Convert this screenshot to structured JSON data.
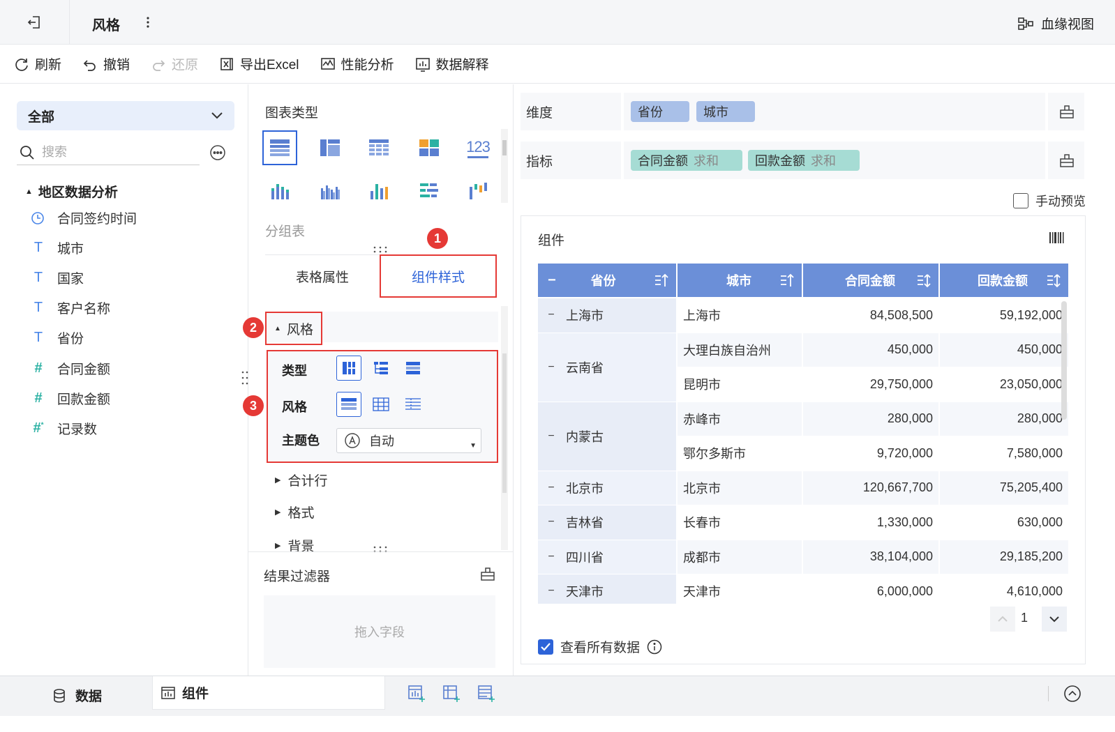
{
  "header": {
    "title": "风格",
    "lineage_label": "血缘视图"
  },
  "toolbar": {
    "refresh": "刷新",
    "undo": "撤销",
    "redo": "还原",
    "export_excel": "导出Excel",
    "perf_analysis": "性能分析",
    "data_explain": "数据解释"
  },
  "left": {
    "dropdown_value": "全部",
    "search_placeholder": "搜索",
    "tree_root": "地区数据分析",
    "fields": [
      {
        "label": "合同签约时间",
        "icon": "clock-icon"
      },
      {
        "label": "城市",
        "icon": "text-type-icon"
      },
      {
        "label": "国家",
        "icon": "text-type-icon"
      },
      {
        "label": "客户名称",
        "icon": "text-type-icon"
      },
      {
        "label": "省份",
        "icon": "text-type-icon"
      },
      {
        "label": "合同金额",
        "icon": "number-type-icon"
      },
      {
        "label": "回款金额",
        "icon": "number-type-icon"
      },
      {
        "label": "记录数",
        "icon": "count-type-icon"
      }
    ]
  },
  "middle": {
    "chart_type_label": "图表类型",
    "chart_type_name": "分组表",
    "chart_type_123": "123",
    "tabs": {
      "table_props": "表格属性",
      "component_style": "组件样式"
    },
    "badges": [
      "1",
      "2",
      "3"
    ],
    "style_section": "风格",
    "style_box": {
      "type_label": "类型",
      "style_label": "风格",
      "theme_label": "主题色",
      "theme_value": "自动"
    },
    "sub_sections": [
      "合计行",
      "格式",
      "背景"
    ],
    "filter_label": "结果过滤器",
    "drop_hint": "拖入字段"
  },
  "right": {
    "dimension_label": "维度",
    "dimensions": [
      "省份",
      "城市"
    ],
    "measure_label": "指标",
    "measures": [
      {
        "name": "合同金额",
        "agg": "求和"
      },
      {
        "name": "回款金额",
        "agg": "求和"
      }
    ],
    "manual_preview": "手动预览",
    "component_title": "组件",
    "table": {
      "columns": [
        "省份",
        "城市",
        "合同金额",
        "回款金额"
      ],
      "rows": [
        {
          "province": "上海市",
          "city": "上海市",
          "contract": "84,508,500",
          "payment": "59,192,000"
        },
        {
          "province": "云南省",
          "city": "大理白族自治州",
          "contract": "450,000",
          "payment": "450,000"
        },
        {
          "province": "",
          "city": "昆明市",
          "contract": "29,750,000",
          "payment": "23,050,000"
        },
        {
          "province": "内蒙古",
          "city": "赤峰市",
          "contract": "280,000",
          "payment": "280,000"
        },
        {
          "province": "",
          "city": "鄂尔多斯市",
          "contract": "9,720,000",
          "payment": "7,580,000"
        },
        {
          "province": "北京市",
          "city": "北京市",
          "contract": "120,667,700",
          "payment": "75,205,400"
        },
        {
          "province": "吉林省",
          "city": "长春市",
          "contract": "1,330,000",
          "payment": "630,000"
        },
        {
          "province": "四川省",
          "city": "成都市",
          "contract": "38,104,000",
          "payment": "29,185,200"
        },
        {
          "province": "天津市",
          "city": "天津市",
          "contract": "6,000,000",
          "payment": "4,610,000"
        }
      ]
    },
    "page_number": "1",
    "view_all_label": "查看所有数据",
    "view_all_checked": true
  },
  "bottom": {
    "data_tab": "数据",
    "component_tab": "组件"
  },
  "colors": {
    "accent": "#2d63d8",
    "highlight": "#e53935",
    "table_header": "#6b8fd8",
    "dimension_pill": "#a9c0e8",
    "measure_pill": "#a6dcd4"
  }
}
